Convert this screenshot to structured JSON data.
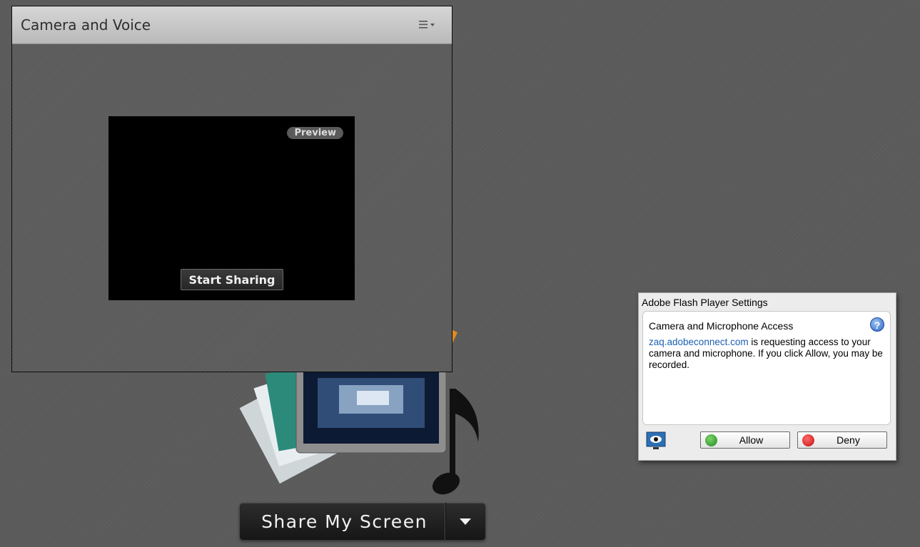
{
  "pod": {
    "title": "Camera and Voice",
    "preview_label": "Preview",
    "start_sharing_label": "Start Sharing",
    "menu_icon": "hamburger-dropdown-icon"
  },
  "share": {
    "button_label": "Share My Screen",
    "dropdown_icon": "caret-down-icon"
  },
  "flash_dialog": {
    "title": "Adobe Flash Player Settings",
    "heading": "Camera and Microphone Access",
    "help_glyph": "?",
    "link_text": "zaq.adobeconnect.com",
    "message_rest": " is requesting access to your camera and microphone. If you click Allow, you may be recorded.",
    "allow_label": "Allow",
    "deny_label": "Deny",
    "colors": {
      "link": "#1b5fb3",
      "allow": "#1e8a1e",
      "deny": "#c30d0d"
    }
  }
}
